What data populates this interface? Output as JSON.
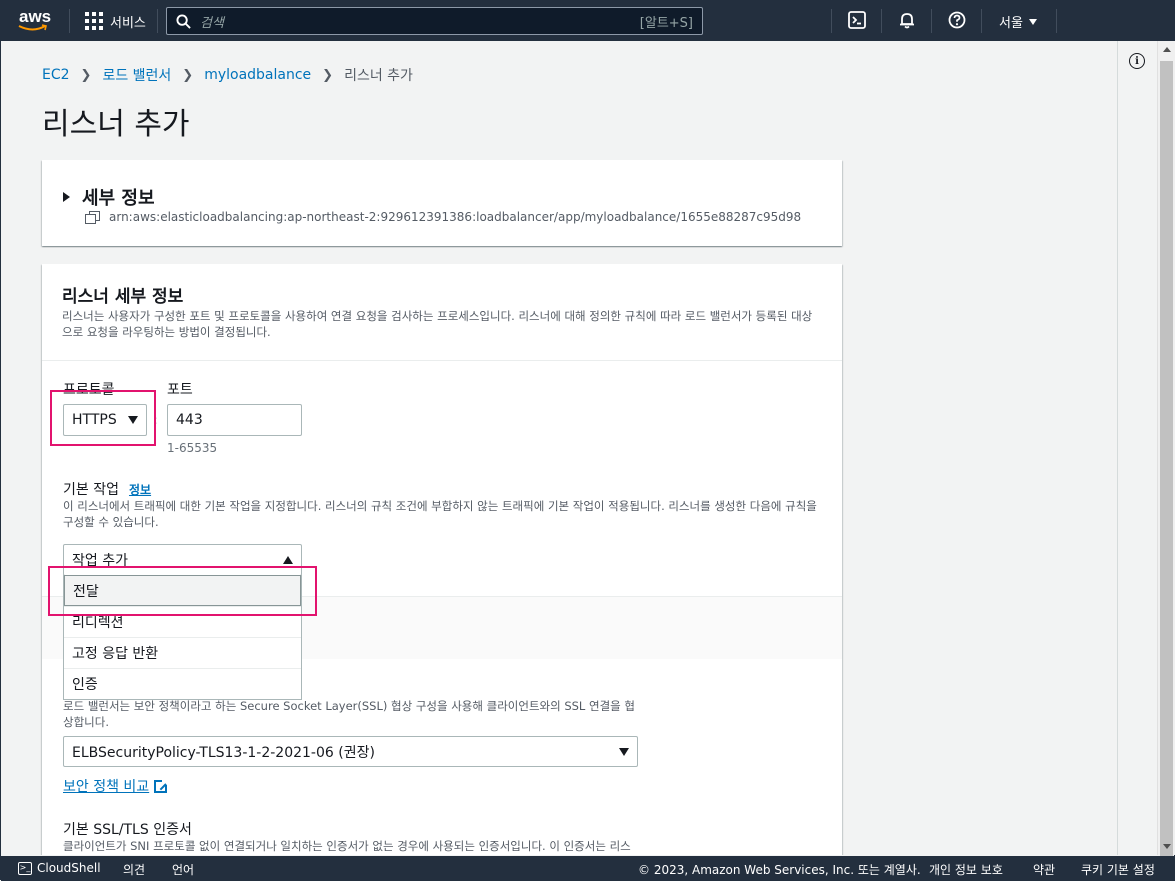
{
  "topnav": {
    "logo_text": "aws",
    "services_label": "서비스",
    "search_placeholder": "검색",
    "search_shortcut": "[알트+S]",
    "region_label": "서울"
  },
  "breadcrumb": {
    "items": [
      "EC2",
      "로드 밸런서",
      "myloadbalance"
    ],
    "current": "리스너 추가"
  },
  "page_title": "리스너 추가",
  "details_card": {
    "title": "세부 정보",
    "arn": "arn:aws:elasticloadbalancing:ap-northeast-2:929612391386:loadbalancer/app/myloadbalance/1655e88287c95d98"
  },
  "listener_card": {
    "title": "리스너 세부 정보",
    "description": "리스너는 사용자가 구성한 포트 및 프로토콜을 사용하여 연결 요청을 검사하는 프로세스입니다. 리스너에 대해 정의한 규칙에 따라 로드 밸런서가 등록된 대상으로 요청을 라우팅하는 방법이 결정됩니다.",
    "protocol_label": "프로토콜",
    "protocol_value": "HTTPS",
    "port_label": "포트",
    "port_value": "443",
    "port_hint": "1-65535",
    "default_action_label": "기본 작업",
    "default_action_info": "정보",
    "default_action_desc": "이 리스너에서 트래픽에 대한 기본 작업을 지정합니다. 리스너의 규칙 조건에 부합하지 않는 트래픽에 기본 작업이 적용됩니다. 리스너를 생성한 다음에 규칙을 구성할 수 있습니다.",
    "action_select": "작업 추가",
    "action_options": [
      "전달",
      "리디렉션",
      "고정 응답 반환",
      "인증"
    ],
    "policy_desc": "로드 밸런서는 보안 정책이라고 하는 Secure Socket Layer(SSL) 협상 구성을 사용해 클라이언트와의 SSL 연결을 협상합니다.",
    "policy_value": "ELBSecurityPolicy-TLS13-1-2-2021-06 (권장)",
    "compare_link": "보안 정책 비교",
    "cert_label": "기본 SSL/TLS 인증서",
    "cert_desc": "클라이언트가 SNI 프로토콜 없이 연결되거나 일치하는 인증서가 없는 경우에 사용되는 인증서입니다. 이 인증서는 리스"
  },
  "footer": {
    "cloudshell": "CloudShell",
    "feedback": "의견",
    "language": "언어",
    "copyright": "© 2023, Amazon Web Services, Inc. 또는 계열사.",
    "privacy": "개인 정보 보호",
    "terms": "약관",
    "cookies": "쿠키 기본 설정"
  },
  "colors": {
    "nav_bg": "#232f3e",
    "link": "#0073bb",
    "highlight": "#e2136e",
    "aws_orange": "#ff9900"
  }
}
